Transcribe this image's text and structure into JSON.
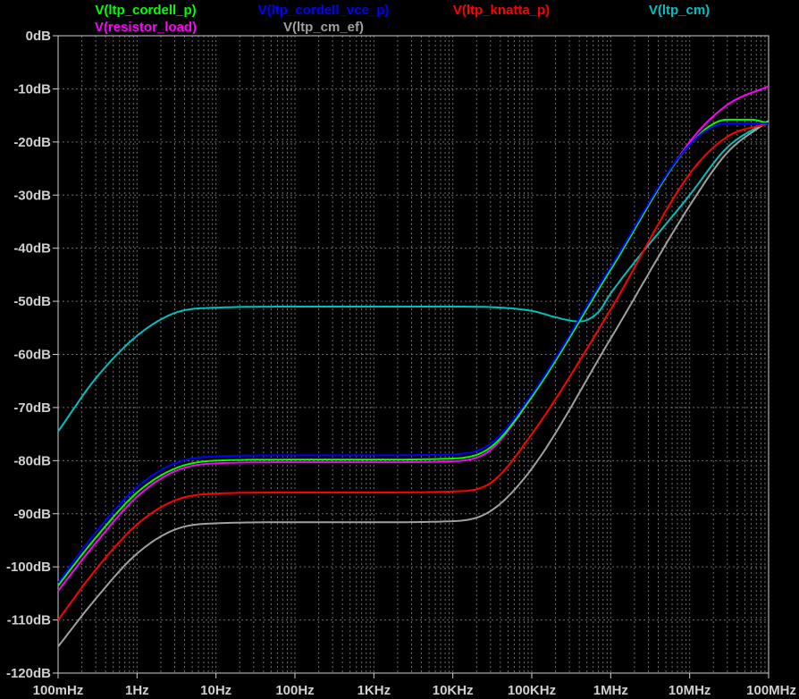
{
  "chart_data": {
    "type": "line",
    "x_scale": "log",
    "x_unit": "Hz",
    "y_unit": "dB",
    "xlim": [
      0.1,
      100000000
    ],
    "ylim": [
      -120,
      0
    ],
    "grid": true,
    "background": "#000000",
    "grid_color": "#6e6e6e",
    "axis_color": "#d0d0d0",
    "x_ticks": [
      {
        "value": 0.1,
        "label": "100mHz"
      },
      {
        "value": 1,
        "label": "1Hz"
      },
      {
        "value": 10,
        "label": "10Hz"
      },
      {
        "value": 100,
        "label": "100Hz"
      },
      {
        "value": 1000,
        "label": "1KHz"
      },
      {
        "value": 10000,
        "label": "10KHz"
      },
      {
        "value": 100000,
        "label": "100KHz"
      },
      {
        "value": 1000000,
        "label": "1MHz"
      },
      {
        "value": 10000000,
        "label": "10MHz"
      },
      {
        "value": 100000000,
        "label": "100MHz"
      }
    ],
    "y_ticks": [
      {
        "value": 0,
        "label": "0dB"
      },
      {
        "value": -10,
        "label": "-10dB"
      },
      {
        "value": -20,
        "label": "-20dB"
      },
      {
        "value": -30,
        "label": "-30dB"
      },
      {
        "value": -40,
        "label": "-40dB"
      },
      {
        "value": -50,
        "label": "-50dB"
      },
      {
        "value": -60,
        "label": "-60dB"
      },
      {
        "value": -70,
        "label": "-70dB"
      },
      {
        "value": -80,
        "label": "-80dB"
      },
      {
        "value": -90,
        "label": "-90dB"
      },
      {
        "value": -100,
        "label": "-100dB"
      },
      {
        "value": -110,
        "label": "-110dB"
      },
      {
        "value": -120,
        "label": "-120dB"
      }
    ],
    "series": [
      {
        "name": "V(ltp_cordell_p)",
        "color": "#00ff00",
        "legend_row": 0,
        "points": [
          [
            0.1,
            -103.5
          ],
          [
            0.3,
            -94.5
          ],
          [
            1,
            -86
          ],
          [
            3,
            -81.5
          ],
          [
            10,
            -80
          ],
          [
            100,
            -79.8
          ],
          [
            1000,
            -79.8
          ],
          [
            10000,
            -79.6
          ],
          [
            30000,
            -77.5
          ],
          [
            100000,
            -68
          ],
          [
            1000000,
            -44
          ],
          [
            10000000,
            -20.5
          ],
          [
            30000000,
            -15.8
          ],
          [
            60000000,
            -15.8
          ],
          [
            100000000,
            -16.5
          ]
        ]
      },
      {
        "name": "V(ltp_cordell_vce_p)",
        "color": "#0000ff",
        "legend_row": 0,
        "points": [
          [
            0.1,
            -103
          ],
          [
            0.3,
            -93.5
          ],
          [
            1,
            -85
          ],
          [
            3,
            -80.5
          ],
          [
            10,
            -79.2
          ],
          [
            100,
            -79
          ],
          [
            1000,
            -79
          ],
          [
            10000,
            -78.8
          ],
          [
            30000,
            -76.8
          ],
          [
            100000,
            -67.5
          ],
          [
            1000000,
            -43.5
          ],
          [
            10000000,
            -20.5
          ],
          [
            30000000,
            -16.5
          ],
          [
            100000000,
            -16.5
          ]
        ]
      },
      {
        "name": "V(ltp_knatta_p)",
        "color": "#ff0000",
        "legend_row": 0,
        "points": [
          [
            0.1,
            -110
          ],
          [
            0.3,
            -100.5
          ],
          [
            1,
            -92
          ],
          [
            3,
            -87.5
          ],
          [
            10,
            -86.2
          ],
          [
            100,
            -86
          ],
          [
            1000,
            -86
          ],
          [
            10000,
            -85.8
          ],
          [
            30000,
            -84.2
          ],
          [
            100000,
            -75
          ],
          [
            1000000,
            -51.5
          ],
          [
            10000000,
            -26
          ],
          [
            30000000,
            -19
          ],
          [
            100000000,
            -16.5
          ]
        ]
      },
      {
        "name": "V(ltp_cm)",
        "color": "#00c0c0",
        "legend_row": 0,
        "points": [
          [
            0.1,
            -74.5
          ],
          [
            0.3,
            -64.5
          ],
          [
            1,
            -56.5
          ],
          [
            3,
            -52.2
          ],
          [
            10,
            -51.2
          ],
          [
            100,
            -51
          ],
          [
            1000,
            -51
          ],
          [
            10000,
            -51
          ],
          [
            100000,
            -51.8
          ],
          [
            200000,
            -53
          ],
          [
            400000,
            -53.8
          ],
          [
            700000,
            -52
          ],
          [
            1000000,
            -48.5
          ],
          [
            10000000,
            -30
          ],
          [
            30000000,
            -21
          ],
          [
            100000000,
            -16
          ]
        ]
      },
      {
        "name": "V(resistor_load)",
        "color": "#ff00ff",
        "legend_row": 1,
        "points": [
          [
            0.1,
            -104.5
          ],
          [
            0.3,
            -95.5
          ],
          [
            1,
            -86.8
          ],
          [
            3,
            -82
          ],
          [
            10,
            -80.5
          ],
          [
            100,
            -80.3
          ],
          [
            1000,
            -80.3
          ],
          [
            10000,
            -80.1
          ],
          [
            30000,
            -78
          ],
          [
            100000,
            -68
          ],
          [
            1000000,
            -44
          ],
          [
            10000000,
            -20
          ],
          [
            30000000,
            -13
          ],
          [
            100000000,
            -9.5
          ]
        ]
      },
      {
        "name": "V(ltp_cm_ef)",
        "color": "#a0a0a0",
        "legend_row": 1,
        "points": [
          [
            0.1,
            -115
          ],
          [
            0.3,
            -106
          ],
          [
            1,
            -97.5
          ],
          [
            3,
            -93
          ],
          [
            10,
            -91.8
          ],
          [
            100,
            -91.6
          ],
          [
            1000,
            -91.6
          ],
          [
            10000,
            -91.4
          ],
          [
            30000,
            -89.5
          ],
          [
            100000,
            -81.5
          ],
          [
            1000000,
            -57
          ],
          [
            10000000,
            -32
          ],
          [
            30000000,
            -22
          ],
          [
            100000000,
            -16
          ]
        ]
      }
    ]
  }
}
